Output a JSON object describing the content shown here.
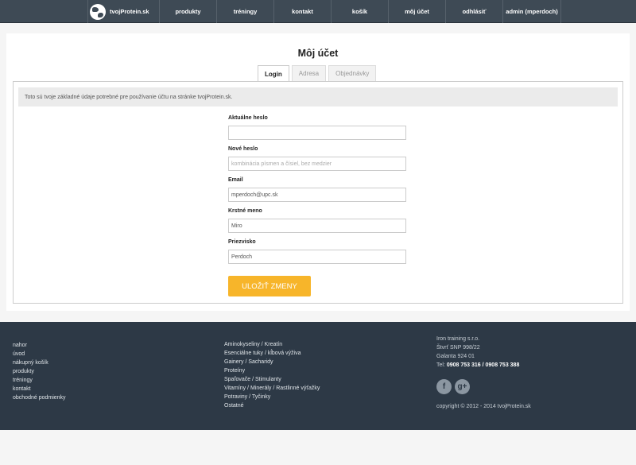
{
  "nav": {
    "logo": "tvojProtein.sk",
    "items": [
      {
        "label": "produkty"
      },
      {
        "label": "tréningy"
      },
      {
        "label": "kontakt"
      },
      {
        "label": "košík"
      },
      {
        "label": "môj účet"
      },
      {
        "label": "odhlásiť"
      },
      {
        "label": "admin (mperdoch)"
      }
    ]
  },
  "page": {
    "title": "Môj účet",
    "tabs": [
      {
        "label": "Login",
        "active": true
      },
      {
        "label": "Adresa",
        "active": false
      },
      {
        "label": "Objednávky",
        "active": false
      }
    ],
    "info": "Toto sú tvoje základné údaje potrebné pre používanie účtu na stránke tvojProtein.sk."
  },
  "form": {
    "current_password": {
      "label": "Aktuálne heslo",
      "value": ""
    },
    "new_password": {
      "label": "Nové heslo",
      "placeholder": "kombinácia písmen a čísiel, bez medzier"
    },
    "email": {
      "label": "Email",
      "value": "mperdoch@upc.sk"
    },
    "first_name": {
      "label": "Krstné meno",
      "value": "Miro"
    },
    "last_name": {
      "label": "Priezvisko",
      "value": "Perdoch"
    },
    "save_label": "ULOŽIŤ ZMENY"
  },
  "footer": {
    "links": [
      "nahor",
      "úvod",
      "nákupný košík",
      "produkty",
      "tréningy",
      "kontakt",
      "obchodné podmienky"
    ],
    "categories": [
      "Aminokyseliny / Kreatín",
      "Esenciálne tuky / kĺbová výživa",
      "Gainery / Sacharidy",
      "Proteíny",
      "Spaľovače / Stimulanty",
      "Vitamíny / Minerály / Rastlinné výťažky",
      "Potraviny / Tyčinky",
      "Ostatné"
    ],
    "company": {
      "name": "Iron training s.r.o.",
      "street": "Štvrť SNP 998/22",
      "city": "Galanta 924 01",
      "tel_label": "Tel:",
      "tel": "0908 753 316 / 0908 753 388"
    },
    "social": [
      {
        "icon": "facebook-icon",
        "glyph": "f"
      },
      {
        "icon": "google-plus-icon",
        "glyph": "g+"
      }
    ],
    "copyright": "copyright © 2012 - 2014 tvojProtein.sk"
  }
}
